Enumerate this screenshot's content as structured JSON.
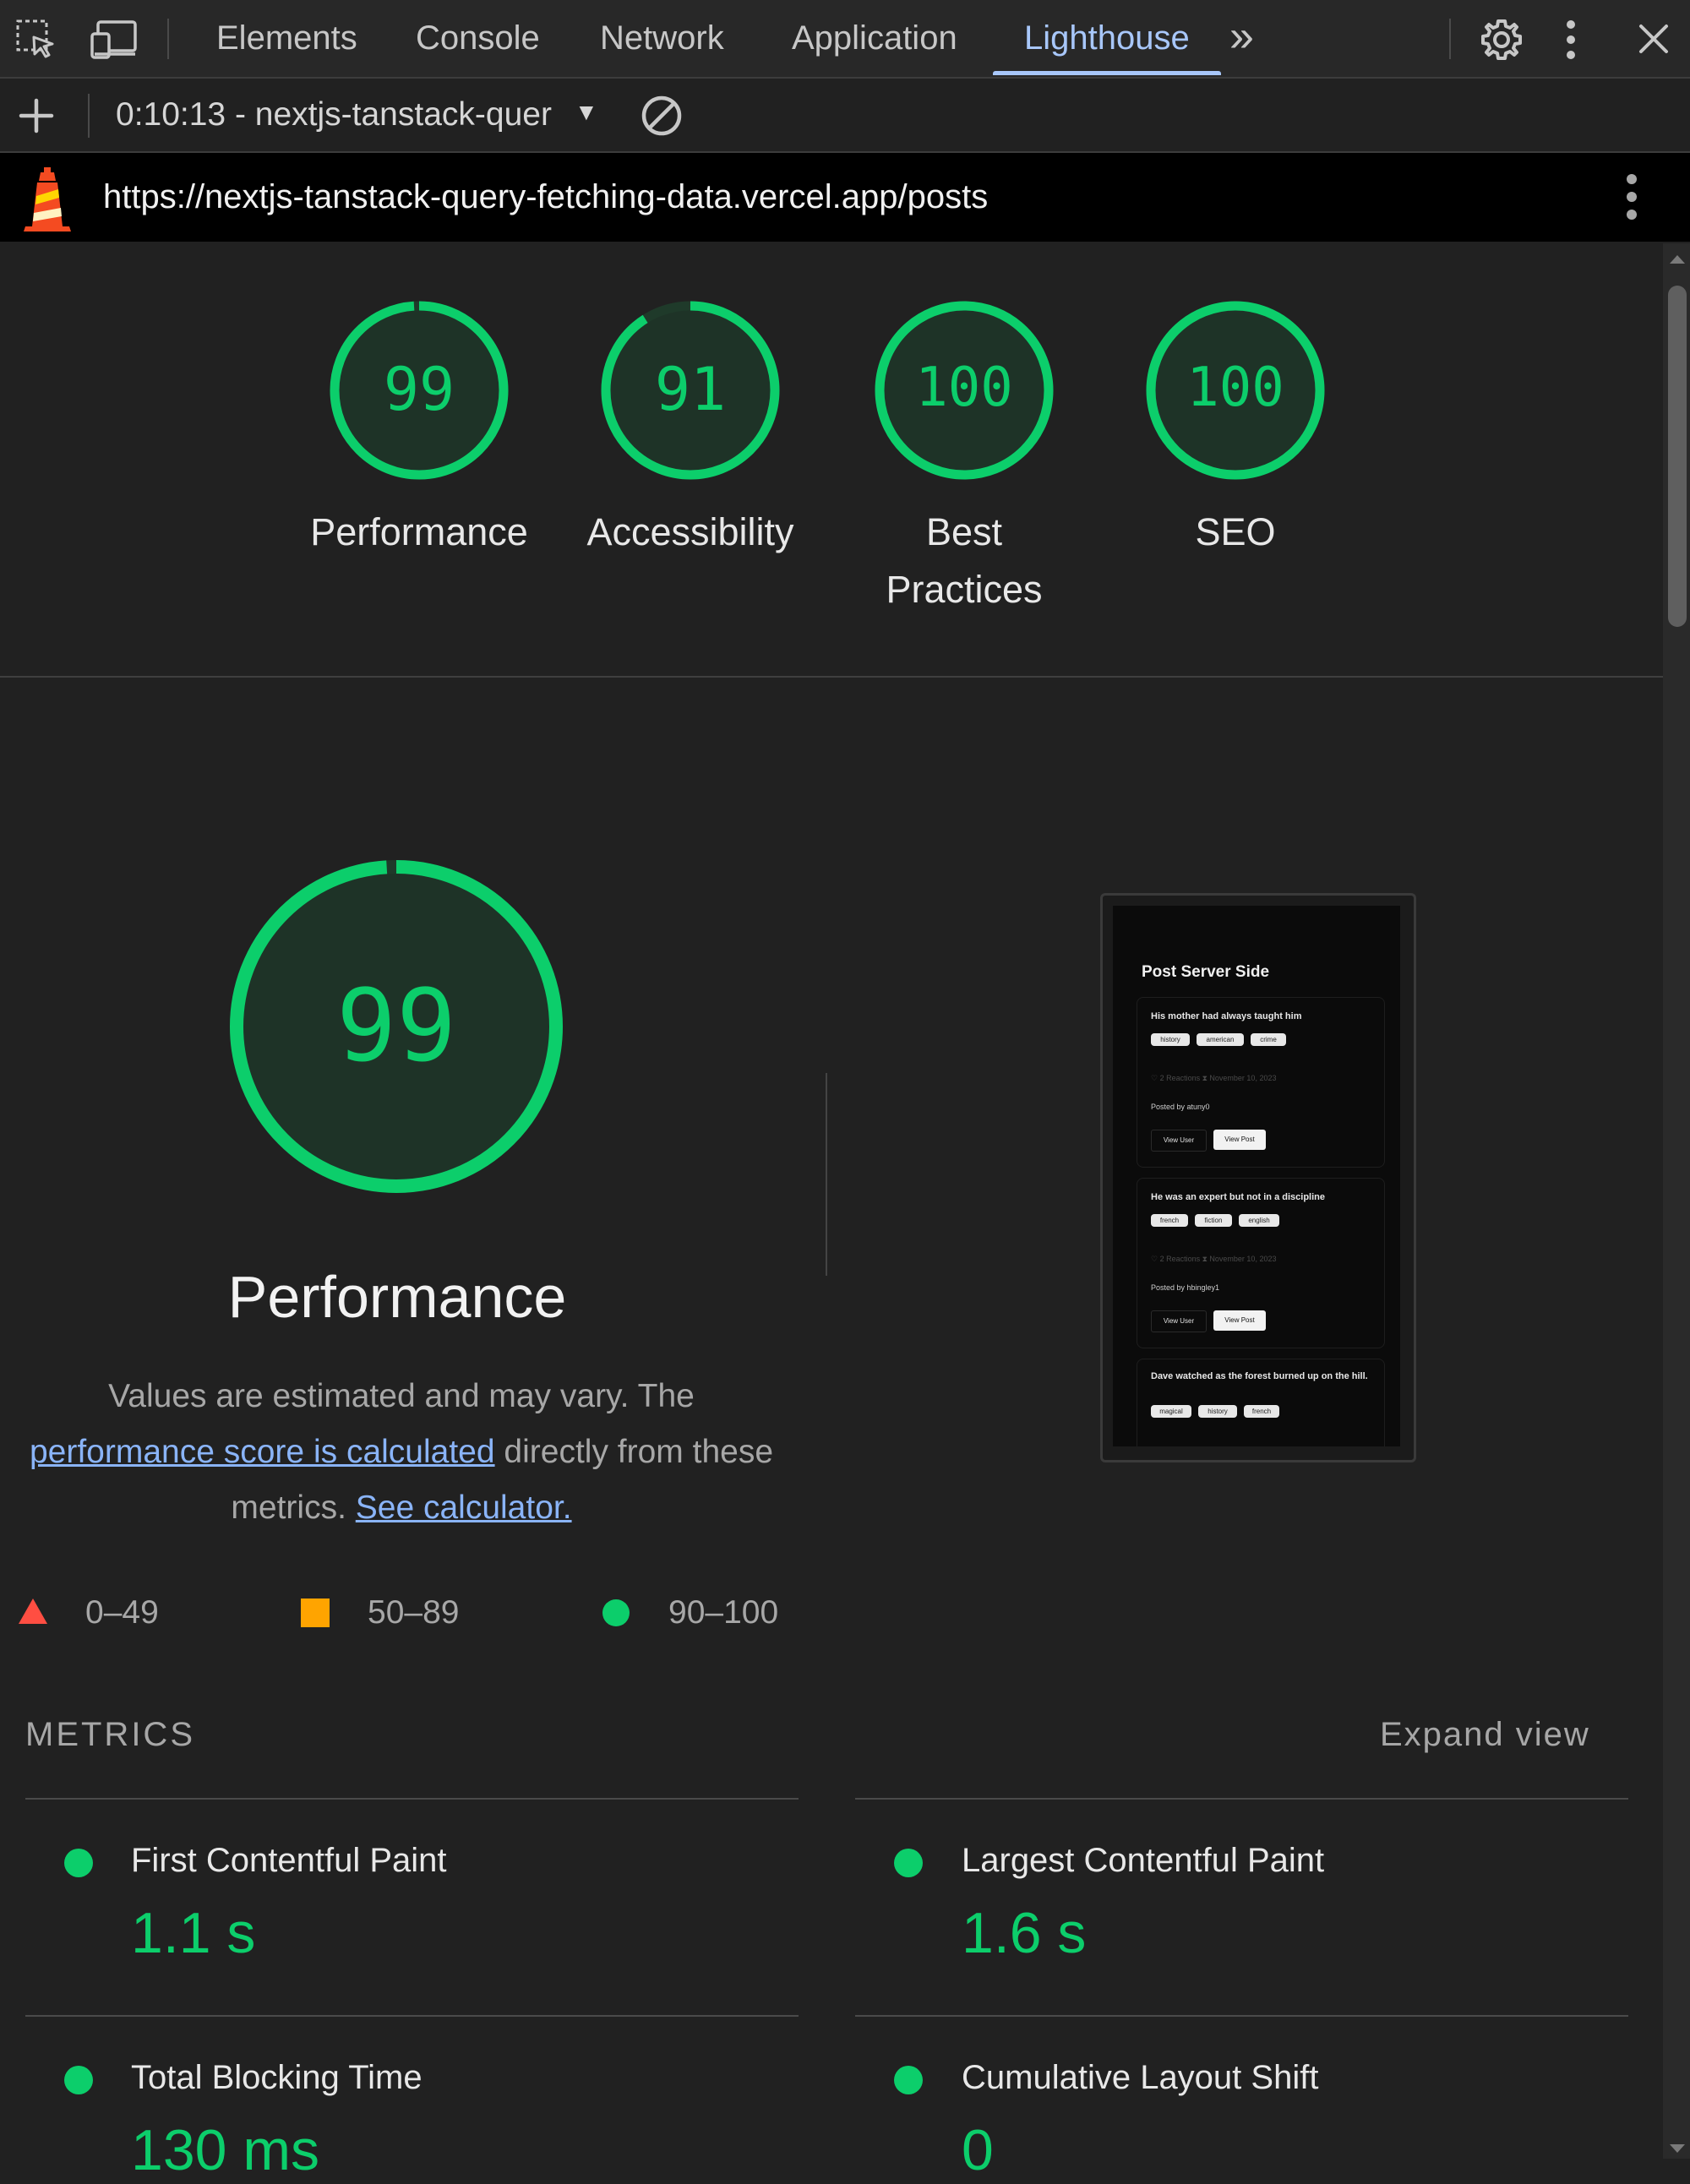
{
  "devtools": {
    "tabs": [
      {
        "label": "Elements"
      },
      {
        "label": "Console"
      },
      {
        "label": "Network"
      },
      {
        "label": "Application"
      },
      {
        "label": "Lighthouse",
        "active": true
      }
    ],
    "more_tabs": "»"
  },
  "toolbar": {
    "report_select": "0:10:13 - nextjs-tanstack-quer",
    "dropdown_arrow": "▼"
  },
  "report": {
    "url": "https://nextjs-tanstack-query-fetching-data.vercel.app/posts"
  },
  "scores": [
    {
      "value": "99",
      "label": "Performance",
      "fraction": 0.99
    },
    {
      "value": "91",
      "label": "Accessibility",
      "fraction": 0.91
    },
    {
      "value": "100",
      "label": "Best Practices",
      "fraction": 1.0
    },
    {
      "value": "100",
      "label": "SEO",
      "fraction": 1.0
    }
  ],
  "performance": {
    "score": "99",
    "fraction": 0.99,
    "title": "Performance",
    "desc_part1": "Values are estimated and may vary. The",
    "desc_link1": "performance score is calculated",
    "desc_part2": "directly from these",
    "desc_part3": "metrics.",
    "desc_link2": "See calculator."
  },
  "legend": [
    {
      "range": "0–49",
      "shape": "triangle",
      "color": "#ff4e42"
    },
    {
      "range": "50–89",
      "shape": "square",
      "color": "#ffa400"
    },
    {
      "range": "90–100",
      "shape": "circle",
      "color": "#0cce6b"
    }
  ],
  "metrics": {
    "title": "METRICS",
    "expand": "Expand view",
    "items": [
      {
        "name": "First Contentful Paint",
        "value": "1.1 s"
      },
      {
        "name": "Largest Contentful Paint",
        "value": "1.6 s"
      },
      {
        "name": "Total Blocking Time",
        "value": "130 ms"
      },
      {
        "name": "Cumulative Layout Shift",
        "value": "0"
      }
    ]
  },
  "thumbnail": {
    "page_title": "Post Server Side",
    "cards": [
      {
        "heading": "His mother had always taught him",
        "tags": [
          "history",
          "american",
          "crime"
        ],
        "meta": "♡ 2 Reactions  ⧗ November 10, 2023",
        "posted_by": "Posted by atuny0",
        "btn_user": "View User",
        "btn_post": "View Post"
      },
      {
        "heading": "He was an expert but not in a discipline",
        "tags": [
          "french",
          "fiction",
          "english"
        ],
        "meta": "♡ 2 Reactions  ⧗ November 10, 2023",
        "posted_by": "Posted by hbingley1",
        "btn_user": "View User",
        "btn_post": "View Post"
      },
      {
        "heading": "Dave watched as the forest burned up on the hill.",
        "tags": [
          "magical",
          "history",
          "french"
        ]
      }
    ]
  },
  "colors": {
    "good": "#0cce6b",
    "gauge_bg": "#1e3327",
    "accent_tab": "#a8c7fa",
    "link": "#8ab4f8"
  }
}
